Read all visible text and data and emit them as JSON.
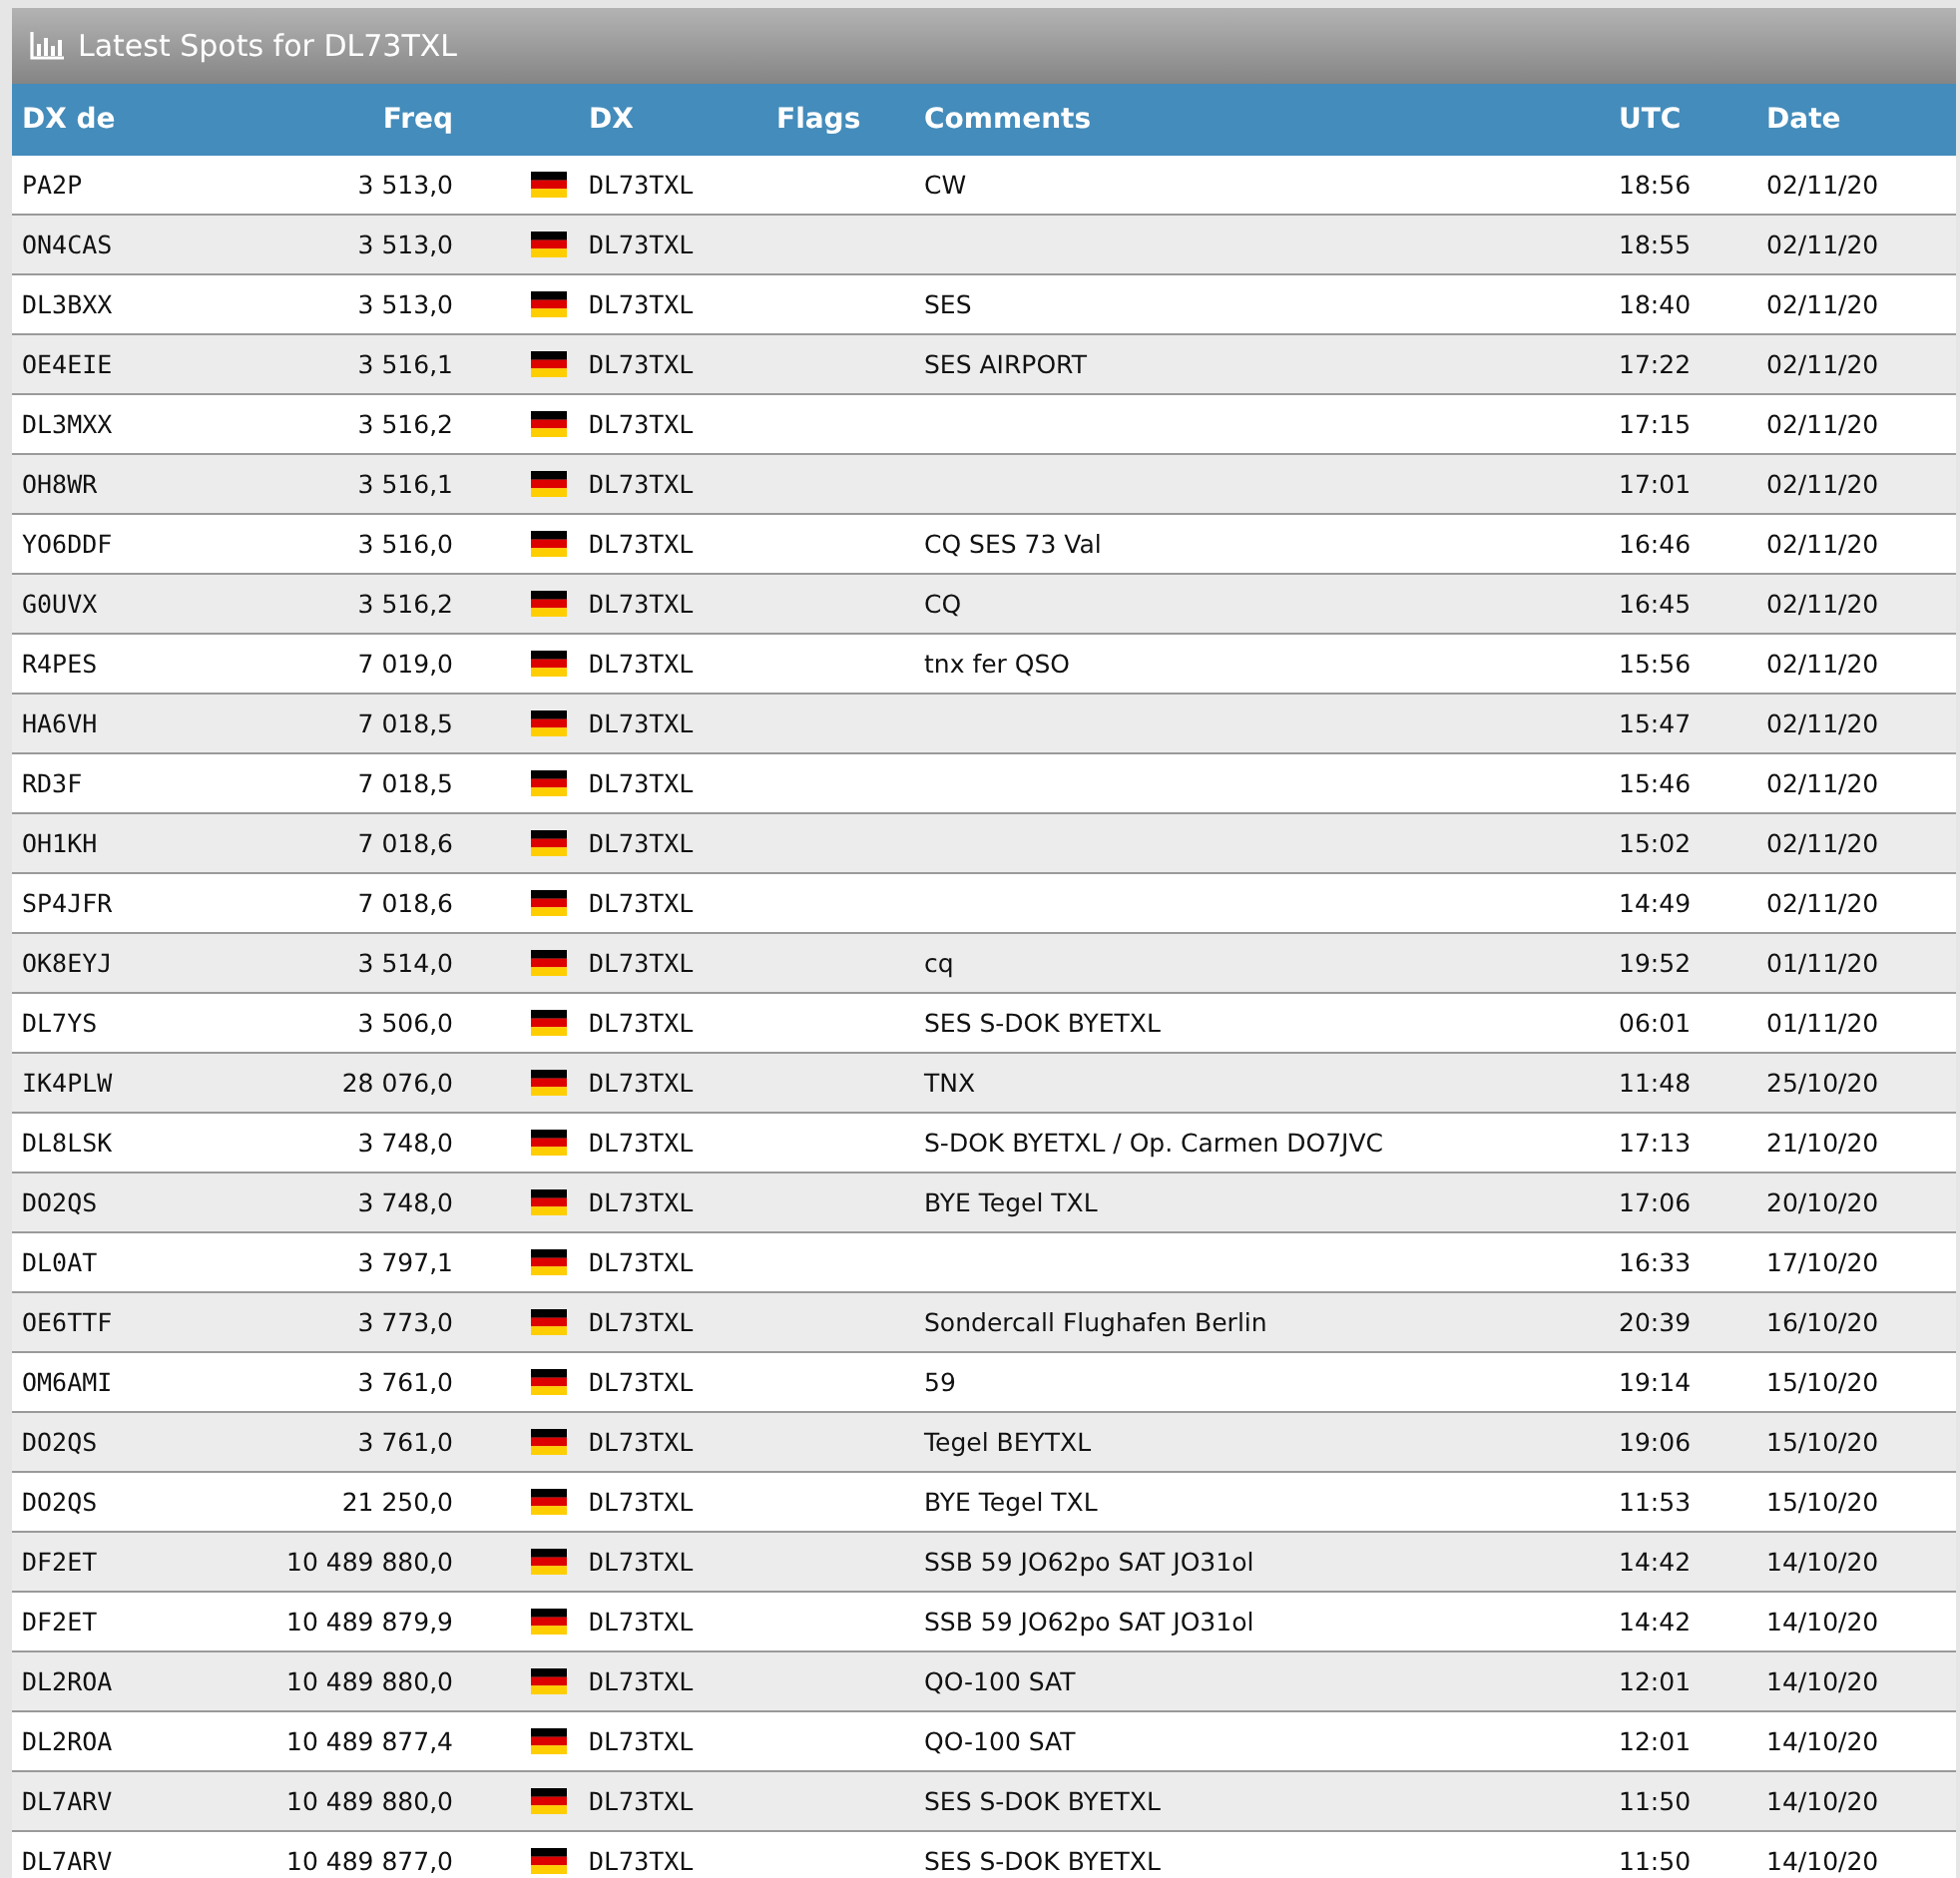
{
  "panel": {
    "title": "Latest Spots for DL73TXL"
  },
  "table": {
    "columns": [
      "DX de",
      "Freq",
      "DX",
      "Flags",
      "Comments",
      "UTC",
      "Date"
    ],
    "rows": [
      {
        "spotter": "PA2P",
        "freq": "3 513,0",
        "dx": "DL73TXL",
        "comments": "CW",
        "utc": "18:56",
        "date": "02/11/20"
      },
      {
        "spotter": "ON4CAS",
        "freq": "3 513,0",
        "dx": "DL73TXL",
        "utc": "18:55",
        "date": "02/11/20"
      },
      {
        "spotter": "DL3BXX",
        "freq": "3 513,0",
        "dx": "DL73TXL",
        "comments": "SES",
        "utc": "18:40",
        "date": "02/11/20"
      },
      {
        "spotter": "OE4EIE",
        "freq": "3 516,1",
        "dx": "DL73TXL",
        "comments": "SES AIRPORT",
        "utc": "17:22",
        "date": "02/11/20"
      },
      {
        "spotter": "DL3MXX",
        "freq": "3 516,2",
        "dx": "DL73TXL",
        "utc": "17:15",
        "date": "02/11/20"
      },
      {
        "spotter": "OH8WR",
        "freq": "3 516,1",
        "dx": "DL73TXL",
        "utc": "17:01",
        "date": "02/11/20"
      },
      {
        "spotter": "YO6DDF",
        "freq": "3 516,0",
        "dx": "DL73TXL",
        "comments": "CQ SES 73 Val",
        "utc": "16:46",
        "date": "02/11/20"
      },
      {
        "spotter": "G0UVX",
        "freq": "3 516,2",
        "dx": "DL73TXL",
        "comments": "CQ",
        "utc": "16:45",
        "date": "02/11/20"
      },
      {
        "spotter": "R4PES",
        "freq": "7 019,0",
        "dx": "DL73TXL",
        "comments": "tnx fer QSO",
        "utc": "15:56",
        "date": "02/11/20"
      },
      {
        "spotter": "HA6VH",
        "freq": "7 018,5",
        "dx": "DL73TXL",
        "utc": "15:47",
        "date": "02/11/20"
      },
      {
        "spotter": "RD3F",
        "freq": "7 018,5",
        "dx": "DL73TXL",
        "utc": "15:46",
        "date": "02/11/20"
      },
      {
        "spotter": "OH1KH",
        "freq": "7 018,6",
        "dx": "DL73TXL",
        "utc": "15:02",
        "date": "02/11/20"
      },
      {
        "spotter": "SP4JFR",
        "freq": "7 018,6",
        "dx": "DL73TXL",
        "utc": "14:49",
        "date": "02/11/20"
      },
      {
        "spotter": "OK8EYJ",
        "freq": "3 514,0",
        "dx": "DL73TXL",
        "comments": "cq",
        "utc": "19:52",
        "date": "01/11/20"
      },
      {
        "spotter": "DL7YS",
        "freq": "3 506,0",
        "dx": "DL73TXL",
        "comments": "SES S-DOK BYETXL",
        "utc": "06:01",
        "date": "01/11/20"
      },
      {
        "spotter": "IK4PLW",
        "freq": "28 076,0",
        "dx": "DL73TXL",
        "comments": "TNX",
        "utc": "11:48",
        "date": "25/10/20"
      },
      {
        "spotter": "DL8LSK",
        "freq": "3 748,0",
        "dx": "DL73TXL",
        "comments": "S-DOK BYETXL / Op. Carmen DO7JVC",
        "utc": "17:13",
        "date": "21/10/20"
      },
      {
        "spotter": "DO2QS",
        "freq": "3 748,0",
        "dx": "DL73TXL",
        "comments": "BYE Tegel TXL",
        "utc": "17:06",
        "date": "20/10/20"
      },
      {
        "spotter": "DL0AT",
        "freq": "3 797,1",
        "dx": "DL73TXL",
        "utc": "16:33",
        "date": "17/10/20"
      },
      {
        "spotter": "OE6TTF",
        "freq": "3 773,0",
        "dx": "DL73TXL",
        "comments": "Sondercall Flughafen Berlin",
        "utc": "20:39",
        "date": "16/10/20"
      },
      {
        "spotter": "OM6AMI",
        "freq": "3 761,0",
        "dx": "DL73TXL",
        "comments": "59",
        "utc": "19:14",
        "date": "15/10/20"
      },
      {
        "spotter": "DO2QS",
        "freq": "3 761,0",
        "dx": "DL73TXL",
        "comments": "Tegel BEYTXL",
        "utc": "19:06",
        "date": "15/10/20"
      },
      {
        "spotter": "DO2QS",
        "freq": "21 250,0",
        "dx": "DL73TXL",
        "comments": "BYE Tegel TXL",
        "utc": "11:53",
        "date": "15/10/20"
      },
      {
        "spotter": "DF2ET",
        "freq": "10 489 880,0",
        "dx": "DL73TXL",
        "comments": "SSB 59 JO62po SAT JO31ol",
        "utc": "14:42",
        "date": "14/10/20"
      },
      {
        "spotter": "DF2ET",
        "freq": "10 489 879,9",
        "dx": "DL73TXL",
        "comments": "SSB 59 JO62po SAT JO31ol",
        "utc": "14:42",
        "date": "14/10/20"
      },
      {
        "spotter": "DL2ROA",
        "freq": "10 489 880,0",
        "dx": "DL73TXL",
        "comments": "QO-100 SAT",
        "utc": "12:01",
        "date": "14/10/20"
      },
      {
        "spotter": "DL2ROA",
        "freq": "10 489 877,4",
        "dx": "DL73TXL",
        "comments": "QO-100 SAT",
        "utc": "12:01",
        "date": "14/10/20"
      },
      {
        "spotter": "DL7ARV",
        "freq": "10 489 880,0",
        "dx": "DL73TXL",
        "comments": "SES S-DOK BYETXL",
        "utc": "11:50",
        "date": "14/10/20"
      },
      {
        "spotter": "DL7ARV",
        "freq": "10 489 877,0",
        "dx": "DL73TXL",
        "comments": "SES S-DOK BYETXL",
        "utc": "11:50",
        "date": "14/10/20"
      }
    ]
  }
}
